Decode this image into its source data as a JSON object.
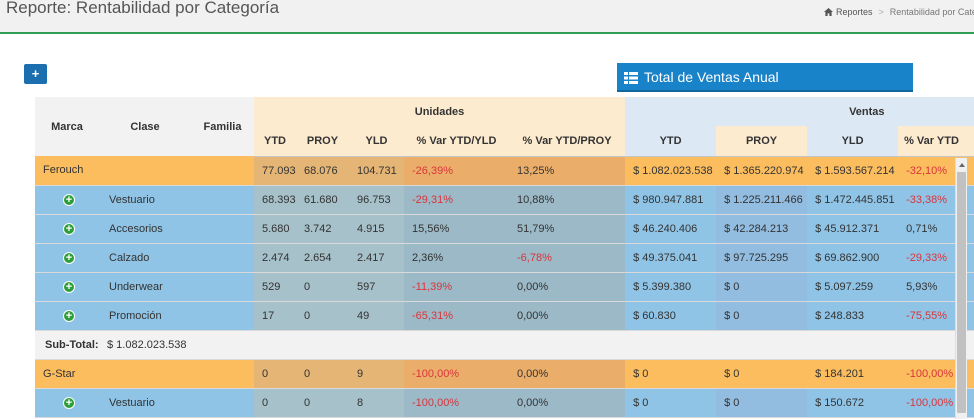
{
  "page": {
    "title": "Reporte: Rentabilidad por Categoría",
    "breadcrumb": {
      "home_label": "Reportes",
      "current": "Rentabilidad por Cate"
    }
  },
  "toolbar": {
    "add_label": "+"
  },
  "panel": {
    "tab_label": "Total de Ventas Anual"
  },
  "table": {
    "group_headers": {
      "units": "Unidades",
      "sales": "Ventas"
    },
    "columns": {
      "marca": "Marca",
      "clase": "Clase",
      "familia": "Familia",
      "u_ytd": "YTD",
      "u_proy": "PROY",
      "u_yld": "YLD",
      "u_var_yld": "% Var YTD/YLD",
      "u_var_proy": "% Var YTD/PROY",
      "s_ytd": "YTD",
      "s_proy": "PROY",
      "s_yld": "YLD",
      "s_var": "% Var YTD"
    },
    "rows": [
      {
        "type": "brand",
        "marca": "Ferouch",
        "clase": "",
        "u_ytd": "77.093",
        "u_proy": "68.076",
        "u_yld": "104.731",
        "u_var_yld": "-26,39%",
        "u_var_proy": "13,25%",
        "s_ytd": "$ 1.082.023.538",
        "s_proy": "$ 1.365.220.974",
        "s_yld": "$ 1.593.567.214",
        "s_var": "-32,10%"
      },
      {
        "type": "child",
        "clase": "Vestuario",
        "u_ytd": "68.393",
        "u_proy": "61.680",
        "u_yld": "96.753",
        "u_var_yld": "-29,31%",
        "u_var_proy": "10,88%",
        "s_ytd": "$ 980.947.881",
        "s_proy": "$ 1.225.211.466",
        "s_yld": "$ 1.472.445.851",
        "s_var": "-33,38%"
      },
      {
        "type": "child",
        "clase": "Accesorios",
        "u_ytd": "5.680",
        "u_proy": "3.742",
        "u_yld": "4.915",
        "u_var_yld": "15,56%",
        "u_var_proy": "51,79%",
        "s_ytd": "$ 46.240.406",
        "s_proy": "$ 42.284.213",
        "s_yld": "$ 45.912.371",
        "s_var": "0,71%"
      },
      {
        "type": "child",
        "clase": "Calzado",
        "u_ytd": "2.474",
        "u_proy": "2.654",
        "u_yld": "2.417",
        "u_var_yld": "2,36%",
        "u_var_proy": "-6,78%",
        "s_ytd": "$ 49.375.041",
        "s_proy": "$ 97.725.295",
        "s_yld": "$ 69.862.900",
        "s_var": "-29,33%"
      },
      {
        "type": "child",
        "clase": "Underwear",
        "u_ytd": "529",
        "u_proy": "0",
        "u_yld": "597",
        "u_var_yld": "-11,39%",
        "u_var_proy": "0,00%",
        "s_ytd": "$ 5.399.380",
        "s_proy": "$ 0",
        "s_yld": "$ 5.097.259",
        "s_var": "5,93%"
      },
      {
        "type": "child",
        "clase": "Promoción",
        "u_ytd": "17",
        "u_proy": "0",
        "u_yld": "49",
        "u_var_yld": "-65,31%",
        "u_var_proy": "0,00%",
        "s_ytd": "$ 60.830",
        "s_proy": "$ 0",
        "s_yld": "$ 248.833",
        "s_var": "-75,55%"
      },
      {
        "type": "subtotal",
        "label": "Sub-Total:",
        "value": "$ 1.082.023.538"
      },
      {
        "type": "brand",
        "marca": "G-Star",
        "clase": "",
        "u_ytd": "0",
        "u_proy": "0",
        "u_yld": "9",
        "u_var_yld": "-100,00%",
        "u_var_proy": "0,00%",
        "s_ytd": "$ 0",
        "s_proy": "$ 0",
        "s_yld": "$ 184.201",
        "s_var": "-100,00%"
      },
      {
        "type": "child",
        "clase": "Vestuario",
        "u_ytd": "0",
        "u_proy": "0",
        "u_yld": "8",
        "u_var_yld": "-100,00%",
        "u_var_proy": "0,00%",
        "s_ytd": "$ 0",
        "s_proy": "$ 0",
        "s_yld": "$ 150.672",
        "s_var": "-100,00%"
      }
    ]
  },
  "colors": {
    "brand_row": "#fbbd5e",
    "child_row": "#8fc4e6",
    "negative": "#d9353b",
    "accent": "#1883c9",
    "expand": "#2e9e3a"
  }
}
